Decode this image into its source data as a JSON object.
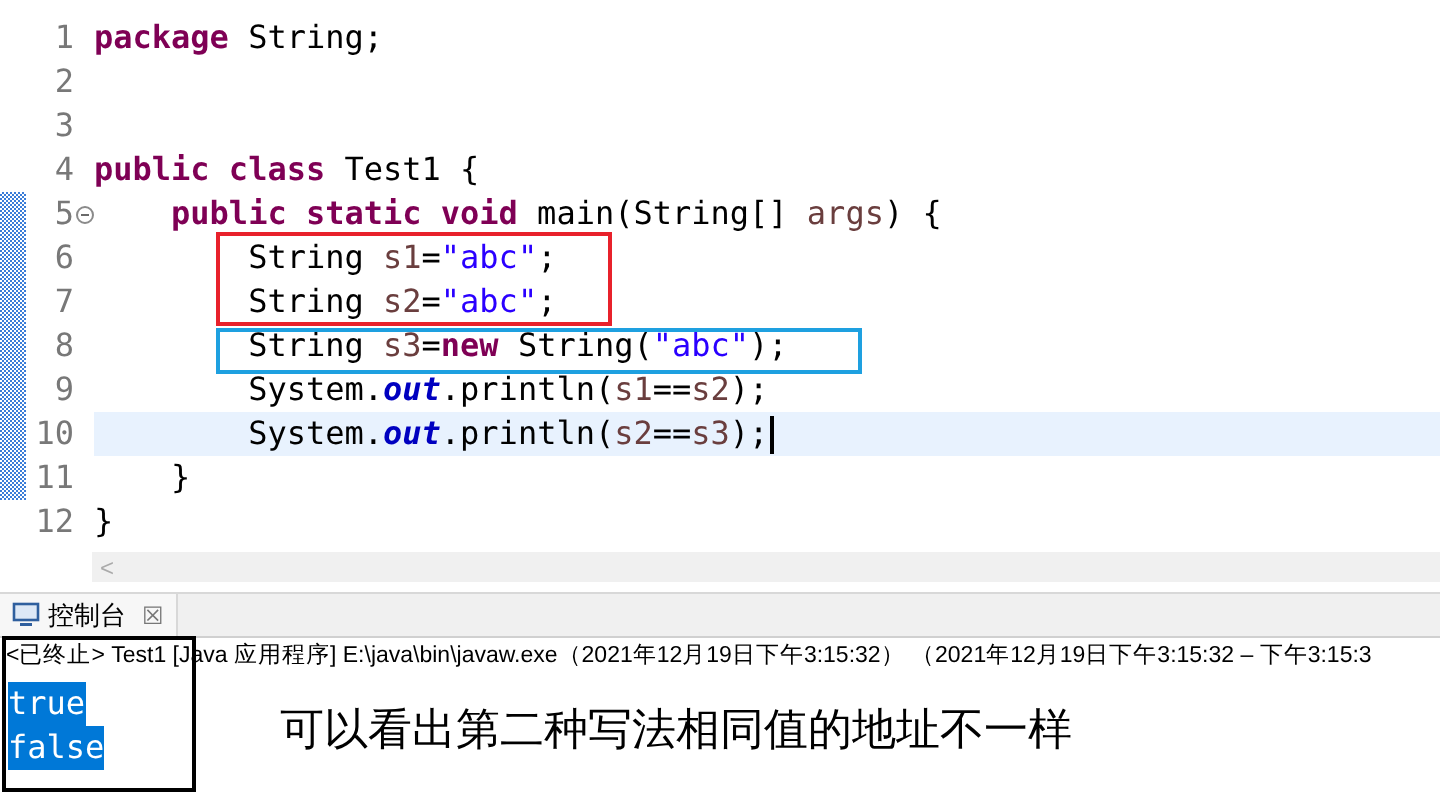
{
  "editor": {
    "lines": [
      {
        "number": "1",
        "foldable": false,
        "marked": false,
        "current": false,
        "tokens": [
          {
            "kind": "keyword",
            "text": "package"
          },
          {
            "kind": "plain",
            "text": " String;"
          }
        ]
      },
      {
        "number": "2",
        "foldable": false,
        "marked": false,
        "current": false
      },
      {
        "number": "3",
        "foldable": false,
        "marked": false,
        "current": false
      },
      {
        "number": "4",
        "foldable": false,
        "marked": false,
        "current": false,
        "tokens": [
          {
            "kind": "keyword",
            "text": "public class"
          },
          {
            "kind": "plain",
            "text": " Test1 {"
          }
        ]
      },
      {
        "number": "5",
        "foldable": true,
        "marked": true,
        "current": false,
        "tokens": [
          {
            "kind": "keyword",
            "text": "    public static void"
          },
          {
            "kind": "plain",
            "text": " main(String[] "
          },
          {
            "kind": "variable",
            "text": "args"
          },
          {
            "kind": "plain",
            "text": ") {"
          }
        ]
      },
      {
        "number": "6",
        "foldable": false,
        "marked": true,
        "current": false,
        "tokens": [
          {
            "kind": "plain",
            "text": "        String "
          },
          {
            "kind": "variable",
            "text": "s1"
          },
          {
            "kind": "plain",
            "text": "="
          },
          {
            "kind": "string",
            "text": "\"abc\""
          },
          {
            "kind": "plain",
            "text": ";"
          }
        ]
      },
      {
        "number": "7",
        "foldable": false,
        "marked": true,
        "current": false,
        "tokens": [
          {
            "kind": "plain",
            "text": "        String "
          },
          {
            "kind": "variable",
            "text": "s2"
          },
          {
            "kind": "plain",
            "text": "="
          },
          {
            "kind": "string",
            "text": "\"abc\""
          },
          {
            "kind": "plain",
            "text": ";"
          }
        ]
      },
      {
        "number": "8",
        "foldable": false,
        "marked": true,
        "current": false,
        "tokens": [
          {
            "kind": "plain",
            "text": "        String "
          },
          {
            "kind": "variable",
            "text": "s3"
          },
          {
            "kind": "plain",
            "text": "="
          },
          {
            "kind": "keyword",
            "text": "new"
          },
          {
            "kind": "plain",
            "text": " String("
          },
          {
            "kind": "string",
            "text": "\"abc\""
          },
          {
            "kind": "plain",
            "text": ");"
          }
        ]
      },
      {
        "number": "9",
        "foldable": false,
        "marked": true,
        "current": false,
        "tokens": [
          {
            "kind": "plain",
            "text": "        System."
          },
          {
            "kind": "field",
            "text": "out"
          },
          {
            "kind": "plain",
            "text": ".println("
          },
          {
            "kind": "variable",
            "text": "s1"
          },
          {
            "kind": "plain",
            "text": "=="
          },
          {
            "kind": "variable",
            "text": "s2"
          },
          {
            "kind": "plain",
            "text": ");"
          }
        ]
      },
      {
        "number": "10",
        "foldable": false,
        "marked": true,
        "current": true,
        "tokens": [
          {
            "kind": "plain",
            "text": "        System."
          },
          {
            "kind": "field",
            "text": "out"
          },
          {
            "kind": "plain",
            "text": ".println("
          },
          {
            "kind": "variable",
            "text": "s2"
          },
          {
            "kind": "plain",
            "text": "=="
          },
          {
            "kind": "variable",
            "text": "s3"
          },
          {
            "kind": "plain",
            "text": ");"
          }
        ]
      },
      {
        "number": "11",
        "foldable": false,
        "marked": true,
        "current": false,
        "tokens": [
          {
            "kind": "plain",
            "text": "    }"
          }
        ]
      },
      {
        "number": "12",
        "foldable": false,
        "marked": false,
        "current": false,
        "tokens": [
          {
            "kind": "plain",
            "text": "}"
          }
        ]
      }
    ],
    "scroll_arrow": "<"
  },
  "annotation_boxes": [
    {
      "color": "#e8212b"
    },
    {
      "color": "#1ea0e0"
    },
    {
      "color": "#000000"
    }
  ],
  "console": {
    "tab": {
      "label": "控制台",
      "close": "☒"
    },
    "status": "<已终止> Test1 [Java 应用程序] E:\\java\\bin\\javaw.exe（2021年12月19日下午3:15:32） （2021年12月19日下午3:15:32 – 下午3:15:3",
    "output": [
      {
        "text": "true",
        "selected": true
      },
      {
        "text": "false",
        "selected": true
      }
    ]
  },
  "note": "可以看出第二种写法相同值的地址不一样"
}
